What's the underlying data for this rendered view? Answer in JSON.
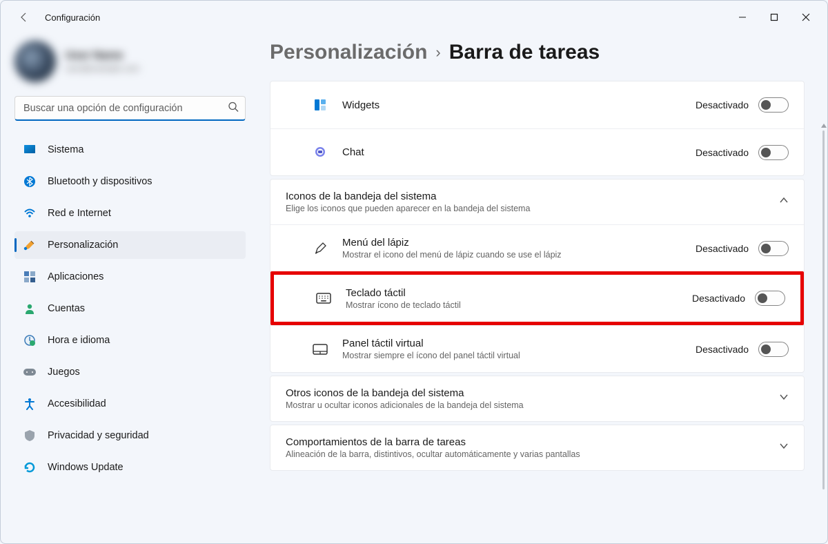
{
  "app": {
    "title": "Configuración"
  },
  "user": {
    "name": "User Name",
    "email": "user@example.com"
  },
  "search": {
    "placeholder": "Buscar una opción de configuración"
  },
  "nav": [
    {
      "id": "sistema",
      "label": "Sistema"
    },
    {
      "id": "bluetooth",
      "label": "Bluetooth y dispositivos"
    },
    {
      "id": "red",
      "label": "Red e Internet"
    },
    {
      "id": "personalizacion",
      "label": "Personalización",
      "active": true
    },
    {
      "id": "aplicaciones",
      "label": "Aplicaciones"
    },
    {
      "id": "cuentas",
      "label": "Cuentas"
    },
    {
      "id": "hora",
      "label": "Hora e idioma"
    },
    {
      "id": "juegos",
      "label": "Juegos"
    },
    {
      "id": "accesibilidad",
      "label": "Accesibilidad"
    },
    {
      "id": "privacidad",
      "label": "Privacidad y seguridad"
    },
    {
      "id": "update",
      "label": "Windows Update"
    }
  ],
  "breadcrumb": {
    "parent": "Personalización",
    "current": "Barra de tareas"
  },
  "top_items": [
    {
      "id": "widgets",
      "label": "Widgets",
      "state": "Desactivado"
    },
    {
      "id": "chat",
      "label": "Chat",
      "state": "Desactivado"
    }
  ],
  "tray_section": {
    "title": "Iconos de la bandeja del sistema",
    "desc": "Elige los iconos que pueden aparecer en la bandeja del sistema",
    "items": [
      {
        "id": "pen",
        "title": "Menú del lápiz",
        "desc": "Mostrar el icono del menú de lápiz cuando se use el lápiz",
        "state": "Desactivado"
      },
      {
        "id": "touch-keyboard",
        "title": "Teclado táctil",
        "desc": "Mostrar ícono de teclado táctil",
        "state": "Desactivado",
        "highlighted": true
      },
      {
        "id": "touchpad",
        "title": "Panel táctil virtual",
        "desc": "Mostrar siempre el ícono del panel táctil virtual",
        "state": "Desactivado"
      }
    ]
  },
  "other_section": {
    "title": "Otros iconos de la bandeja del sistema",
    "desc": "Mostrar u ocultar iconos adicionales de la bandeja del sistema"
  },
  "behavior_section": {
    "title": "Comportamientos de la barra de tareas",
    "desc": "Alineación de la barra, distintivos, ocultar automáticamente y varias pantallas"
  }
}
